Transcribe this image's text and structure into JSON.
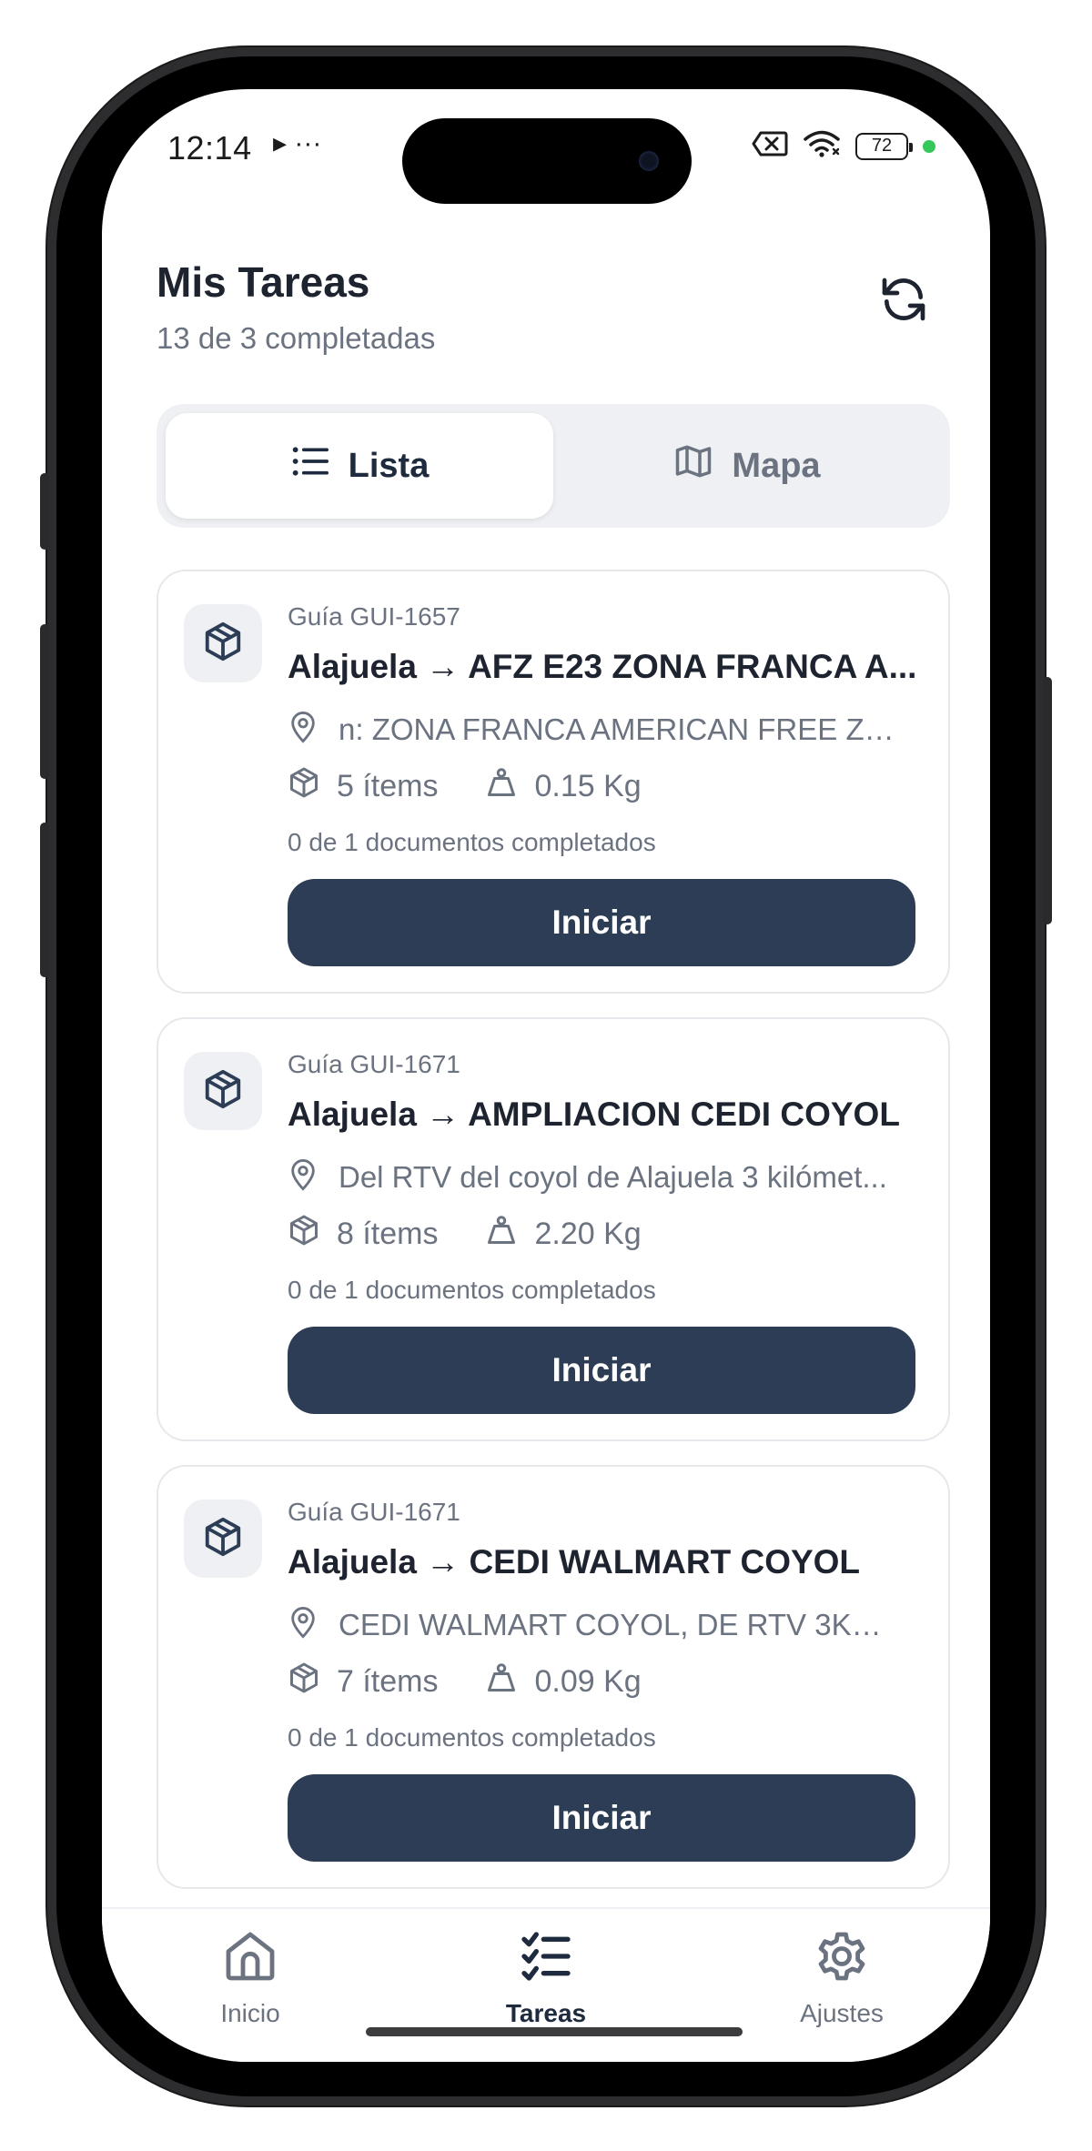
{
  "status_bar": {
    "time": "12:14",
    "extra": "▸ ···",
    "battery": "72"
  },
  "header": {
    "title": "Mis Tareas",
    "subtitle": "13 de 3 completadas"
  },
  "view_toggle": {
    "list_label": "Lista",
    "map_label": "Mapa",
    "selected": "Lista"
  },
  "tasks": [
    {
      "guide": "Guía GUI-1657",
      "route": "Alajuela → AFZ E23 ZONA FRANCA A...",
      "address": "n: ZONA FRANCA AMERICAN FREE ZO...",
      "items": "5 ítems",
      "weight": "0.15 Kg",
      "docs": "0 de 1 documentos completados",
      "action": "Iniciar"
    },
    {
      "guide": "Guía GUI-1671",
      "route": "Alajuela → AMPLIACION CEDI COYOL",
      "address": "Del RTV del coyol de Alajuela 3 kilómet...",
      "items": "8 ítems",
      "weight": "2.20 Kg",
      "docs": "0 de 1 documentos completados",
      "action": "Iniciar"
    },
    {
      "guide": "Guía GUI-1671",
      "route": "Alajuela → CEDI WALMART COYOL",
      "address": "CEDI WALMART COYOL, DE RTV 3KM ...",
      "items": "7 ítems",
      "weight": "0.09 Kg",
      "docs": "0 de 1 documentos completados",
      "action": "Iniciar"
    }
  ],
  "bottom_nav": {
    "items": [
      {
        "label": "Inicio",
        "icon": "home-icon"
      },
      {
        "label": "Tareas",
        "icon": "tasks-icon"
      },
      {
        "label": "Ajustes",
        "icon": "gear-icon"
      }
    ],
    "active": "Tareas"
  },
  "colors": {
    "primary_button": "#2c3d55",
    "text_dark": "#1e2330",
    "text_muted": "#6b7280",
    "segment_bg": "#eef0f3"
  }
}
